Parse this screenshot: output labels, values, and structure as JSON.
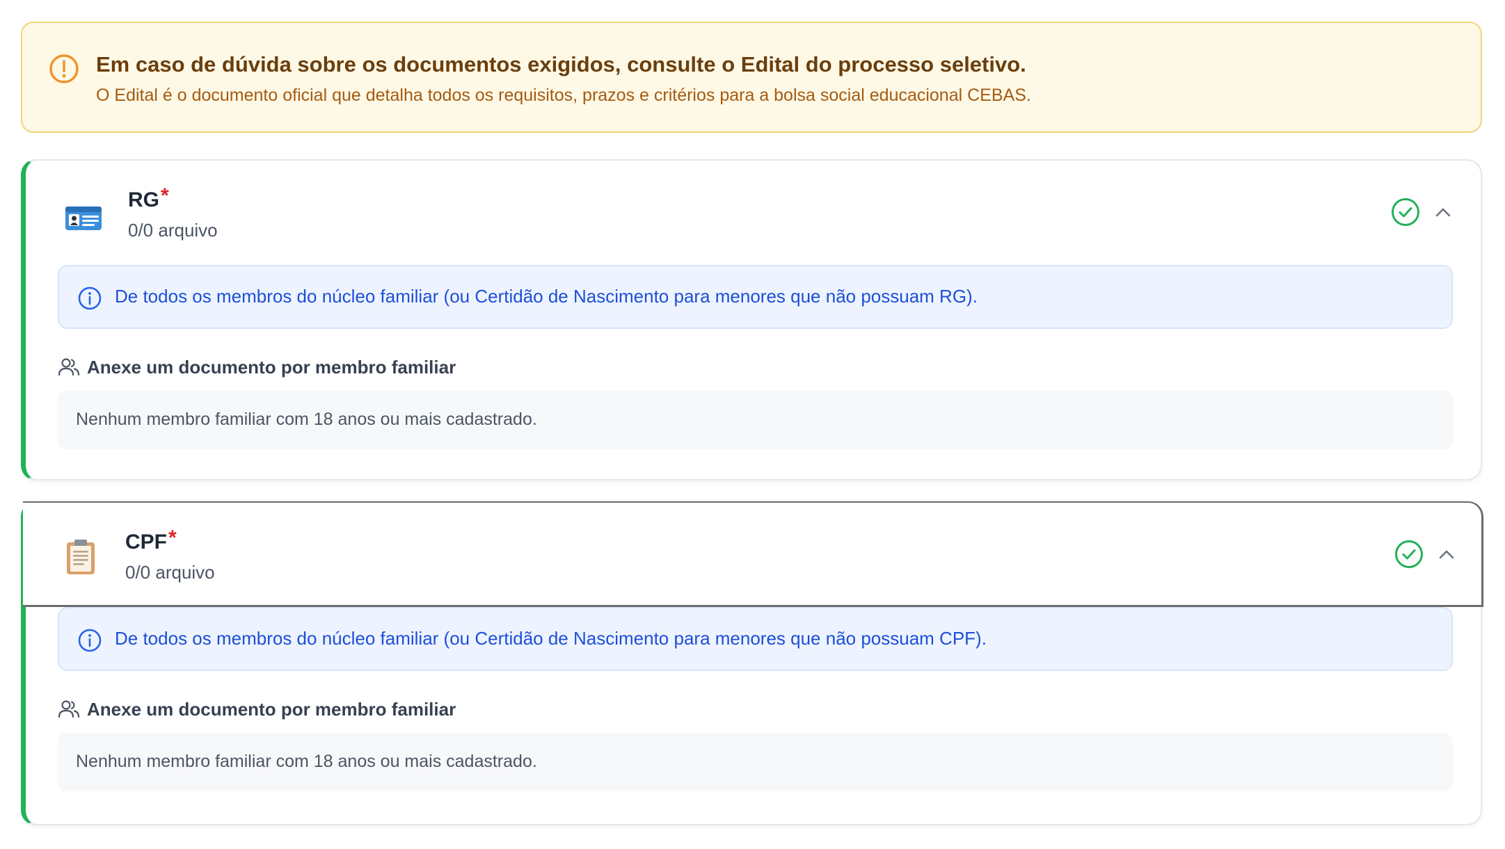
{
  "alert": {
    "title": "Em caso de dúvida sobre os documentos exigidos, consulte o Edital do processo seletivo.",
    "text": "O Edital é o documento oficial que detalha todos os requisitos, prazos e critérios para a bolsa social educacional CEBAS.",
    "icon": "warning-circle-icon",
    "color": "#f5a23a"
  },
  "documents": [
    {
      "title": "RG",
      "required_mark": "*",
      "count": "0/0 arquivo",
      "icon": "id-card-icon",
      "status_icon": "check-circle-icon",
      "info": "De todos os membros do núcleo familiar (ou Certidão de Nascimento para menores que não possuam RG).",
      "attach_label": "Anexe um documento por membro familiar",
      "empty_message": "Nenhum membro familiar com 18 anos ou mais cadastrado."
    },
    {
      "title": "CPF",
      "required_mark": "*",
      "count": "0/0 arquivo",
      "icon": "clipboard-icon",
      "status_icon": "check-circle-icon",
      "info": "De todos os membros do núcleo familiar (ou Certidão de Nascimento para menores que não possuam CPF).",
      "attach_label": "Anexe um documento por membro familiar",
      "empty_message": "Nenhum membro familiar com 18 anos ou mais cadastrado."
    }
  ],
  "colors": {
    "accent_green": "#22b157",
    "required_red": "#e02424",
    "info_blue": "#1d4ed8",
    "warning_bg": "#fef9e7"
  }
}
